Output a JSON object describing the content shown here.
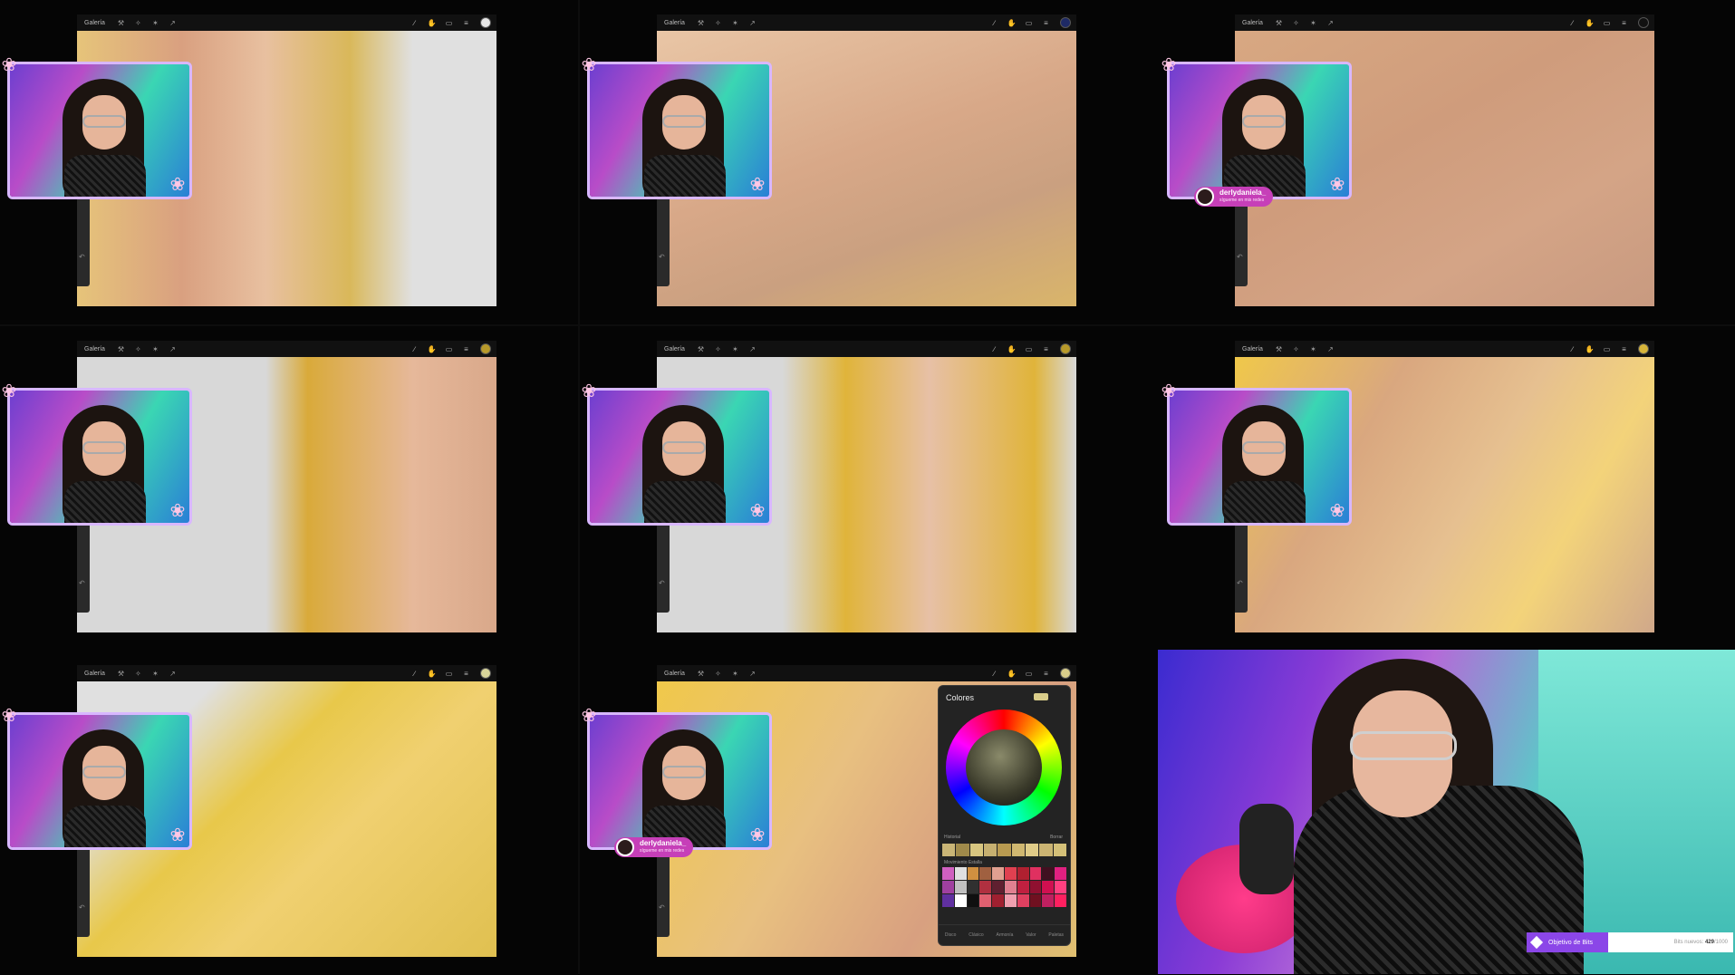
{
  "app": {
    "gallery_label": "Galería",
    "tool_icons": [
      "wrench-icon",
      "magic-wand-icon",
      "selection-icon",
      "transform-icon"
    ],
    "right_icons": [
      "brush-icon",
      "smudge-icon",
      "eraser-icon",
      "layers-icon"
    ]
  },
  "panels": [
    {
      "id": "p1",
      "color": "#e6e6e6"
    },
    {
      "id": "p2",
      "color": "#1e2a66"
    },
    {
      "id": "p3",
      "color": "#111111"
    },
    {
      "id": "p4",
      "color": "#b89a2a"
    },
    {
      "id": "p5",
      "color": "#b89a2a"
    },
    {
      "id": "p6",
      "color": "#d6b43a"
    },
    {
      "id": "p7",
      "color": "#d9d59a"
    },
    {
      "id": "p8",
      "color": "#d9cd8a"
    }
  ],
  "badge": {
    "name": "derlydaniela_",
    "sub": "sígueme en mis redes"
  },
  "colors_panel": {
    "title": "Colores",
    "history_label": "Historial",
    "history_clear": "Borrar",
    "palette_label": "Movimiento Estalla",
    "tabs": [
      "Disco",
      "Clásico",
      "Armonía",
      "Valor",
      "Paletas"
    ]
  },
  "bits": {
    "label": "Objetivo de Bits",
    "prefix": "Bits nuevos:",
    "current": "429",
    "goal": "/1000"
  }
}
